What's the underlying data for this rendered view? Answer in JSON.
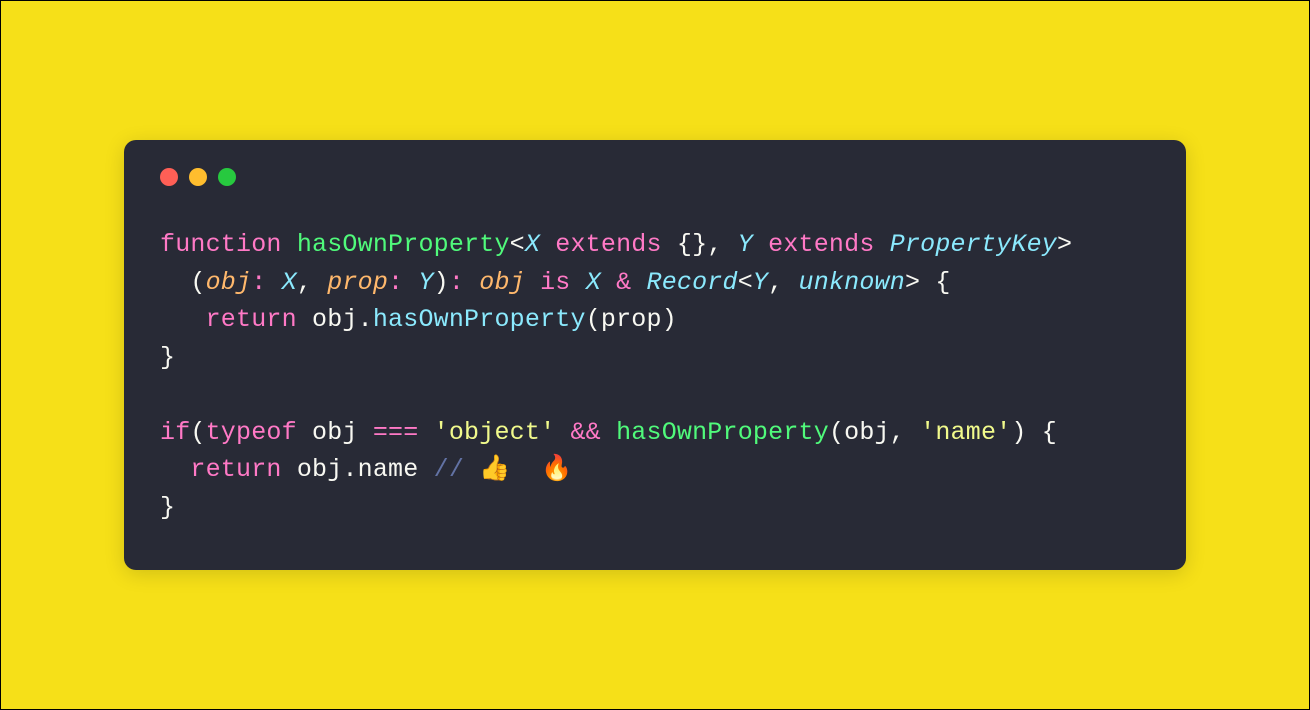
{
  "colors": {
    "page_bg": "#f6e018",
    "window_bg": "#282a36",
    "dot_red": "#ff5f56",
    "dot_yellow": "#ffbd2e",
    "dot_green": "#27c93f",
    "keyword": "#ff79c6",
    "funcname": "#50fa7b",
    "type": "#8be9fd",
    "param": "#ffb86c",
    "plain": "#f8f8f2",
    "string": "#f1fa8c",
    "comment": "#6272a4"
  },
  "tokens": {
    "l1": {
      "kw_function": "function",
      "sp1": " ",
      "fn_name": "hasOwnProperty",
      "lt1": "<",
      "type_X": "X",
      "sp2": " ",
      "kw_extends1": "extends",
      "sp3": " ",
      "braces_empty": "{}",
      "comma1": ",",
      "sp4": " ",
      "type_Y": "Y",
      "sp5": " ",
      "kw_extends2": "extends",
      "sp6": " ",
      "type_PropertyKey": "PropertyKey",
      "gt1": ">"
    },
    "l2": {
      "indent": "  ",
      "lparen": "(",
      "param_obj": "obj",
      "colon1": ":",
      "sp1": " ",
      "type_X": "X",
      "comma": ",",
      "sp2": " ",
      "param_prop": "prop",
      "colon2": ":",
      "sp3": " ",
      "type_Y": "Y",
      "rparen": ")",
      "colon3": ":",
      "sp4": " ",
      "param_obj2": "obj",
      "sp5": " ",
      "kw_is": "is",
      "sp6": " ",
      "type_X2": "X",
      "sp7": " ",
      "op_amp": "&",
      "sp8": " ",
      "type_Record": "Record",
      "lt": "<",
      "type_Y2": "Y",
      "comma2": ",",
      "sp9": " ",
      "type_unknown": "unknown",
      "gt": ">",
      "sp10": " ",
      "lbrace": "{"
    },
    "l3": {
      "indent": "   ",
      "kw_return": "return",
      "sp1": " ",
      "obj": "obj",
      "dot": ".",
      "method": "hasOwnProperty",
      "lparen": "(",
      "arg": "prop",
      "rparen": ")"
    },
    "l4": {
      "rbrace": "}"
    },
    "l5": {
      "blank": ""
    },
    "l6": {
      "kw_if": "if",
      "lparen": "(",
      "kw_typeof": "typeof",
      "sp1": " ",
      "obj": "obj",
      "sp2": " ",
      "op_eq": "===",
      "sp3": " ",
      "str_object": "'object'",
      "sp4": " ",
      "op_and": "&&",
      "sp5": " ",
      "fn_call": "hasOwnProperty",
      "lparen2": "(",
      "arg_obj": "obj",
      "comma": ",",
      "sp6": " ",
      "str_name": "'name'",
      "rparen2": ")",
      "sp7": " ",
      "lbrace": "{"
    },
    "l7": {
      "indent": "  ",
      "kw_return": "return",
      "sp1": " ",
      "obj": "obj",
      "dot": ".",
      "prop": "name",
      "sp2": " ",
      "comment_start": "// ",
      "emoji1": "👍",
      "sp3": "  ",
      "emoji2": "🔥"
    },
    "l8": {
      "rbrace": "}"
    }
  }
}
